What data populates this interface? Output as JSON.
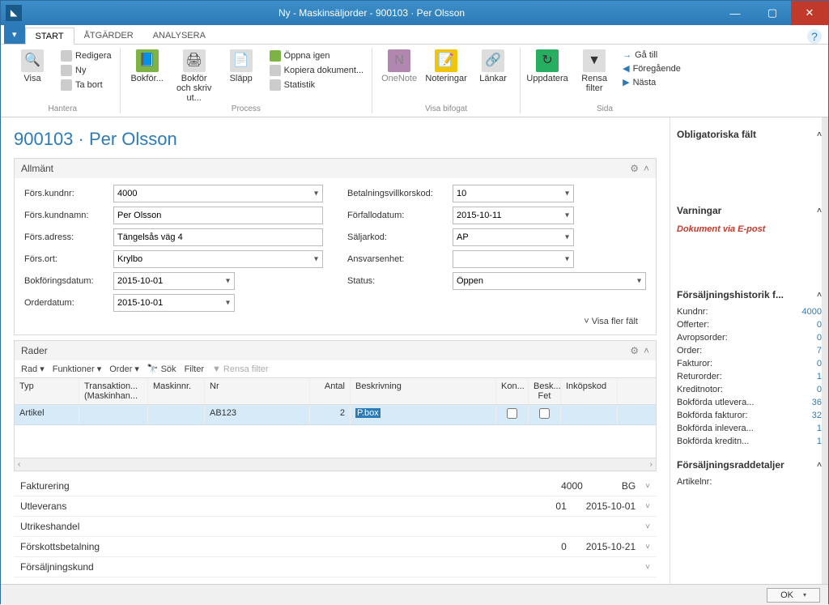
{
  "window": {
    "title": "Ny - Maskinsäljorder - 900103 · Per Olsson"
  },
  "ribbon": {
    "file_dropdown": "▾",
    "tabs": {
      "start": "START",
      "actions": "ÅTGÄRDER",
      "analyze": "ANALYSERA"
    },
    "hantera": {
      "visa": "Visa",
      "edit": "Redigera",
      "new": "Ny",
      "delete": "Ta bort",
      "label": "Hantera"
    },
    "process": {
      "bokfor": "Bokför...",
      "bokfor_skriv": "Bokför och skriv ut...",
      "slapp": "Släpp",
      "open_again": "Öppna igen",
      "copy_doc": "Kopiera dokument...",
      "stats": "Statistik",
      "label": "Process"
    },
    "bifogat": {
      "onenote": "OneNote",
      "noteringar": "Noteringar",
      "lankar": "Länkar",
      "label": "Visa bifogat"
    },
    "uppdatera": "Uppdatera",
    "rensa": "Rensa filter",
    "sida": {
      "goto": "Gå till",
      "prev": "Föregående",
      "next": "Nästa",
      "label": "Sida"
    }
  },
  "page": {
    "title": "900103 · Per Olsson"
  },
  "allmant": {
    "header": "Allmänt",
    "fields": {
      "kundnr": {
        "label": "Förs.kundnr:",
        "value": "4000"
      },
      "kundnamn": {
        "label": "Förs.kundnamn:",
        "value": "Per Olsson"
      },
      "adress": {
        "label": "Förs.adress:",
        "value": "Tängelsås väg 4"
      },
      "ort": {
        "label": "Förs.ort:",
        "value": "Krylbo"
      },
      "bokfdatum": {
        "label": "Bokföringsdatum:",
        "value": "2015-10-01"
      },
      "orderdatum": {
        "label": "Orderdatum:",
        "value": "2015-10-01"
      },
      "betvillkor": {
        "label": "Betalningsvillkorskod:",
        "value": "10"
      },
      "forfallo": {
        "label": "Förfallodatum:",
        "value": "2015-10-11"
      },
      "saljarkod": {
        "label": "Säljarkod:",
        "value": "AP"
      },
      "ansvarsenhet": {
        "label": "Ansvarsenhet:",
        "value": ""
      },
      "status": {
        "label": "Status:",
        "value": "Öppen"
      }
    },
    "morefields": "Visa fler fält"
  },
  "rader": {
    "header": "Rader",
    "toolbar": {
      "rad": "Rad",
      "funk": "Funktioner",
      "order": "Order",
      "sok": "Sök",
      "filter": "Filter",
      "rensa": "Rensa filter"
    },
    "cols": {
      "typ": "Typ",
      "trans": "Transaktion... (Maskinhan...",
      "mask": "Maskinnr.",
      "nr": "Nr",
      "antal": "Antal",
      "besk": "Beskrivning",
      "kon": "Kon...",
      "fet": "Besk... Fet",
      "ink": "Inköpskod"
    },
    "row1": {
      "typ": "Artikel",
      "trans": "",
      "mask": "",
      "nr": "AB123",
      "antal": "2",
      "besk": "P.box",
      "kon": false,
      "fet": false,
      "ink": ""
    }
  },
  "summary": [
    {
      "label": "Fakturering",
      "v1": "4000",
      "v2": "",
      "v3": "BG"
    },
    {
      "label": "Utleverans",
      "v1": "",
      "v2": "01",
      "v3": "2015-10-01"
    },
    {
      "label": "Utrikeshandel",
      "v1": "",
      "v2": "",
      "v3": ""
    },
    {
      "label": "Förskottsbetalning",
      "v1": "",
      "v2": "0",
      "v3": "2015-10-21"
    },
    {
      "label": "Försäljningskund",
      "v1": "",
      "v2": "",
      "v3": ""
    }
  ],
  "side": {
    "oblig": {
      "header": "Obligatoriska fält"
    },
    "varn": {
      "header": "Varningar",
      "msg": "Dokument via E-post"
    },
    "hist": {
      "header": "Försäljningshistorik f...",
      "rows": [
        {
          "k": "Kundnr:",
          "v": "4000"
        },
        {
          "k": "Offerter:",
          "v": "0"
        },
        {
          "k": "Avropsorder:",
          "v": "0"
        },
        {
          "k": "Order:",
          "v": "7"
        },
        {
          "k": "Fakturor:",
          "v": "0"
        },
        {
          "k": "Returorder:",
          "v": "1"
        },
        {
          "k": "Kreditnotor:",
          "v": "0"
        },
        {
          "k": "Bokförda utlevera...",
          "v": "36"
        },
        {
          "k": "Bokförda fakturor:",
          "v": "32"
        },
        {
          "k": "Bokförda inlevera...",
          "v": "1"
        },
        {
          "k": "Bokförda kreditn...",
          "v": "1"
        }
      ]
    },
    "detail": {
      "header": "Försäljningsraddetaljer",
      "artikelnr": "Artikelnr:"
    }
  },
  "footer": {
    "ok": "OK"
  }
}
